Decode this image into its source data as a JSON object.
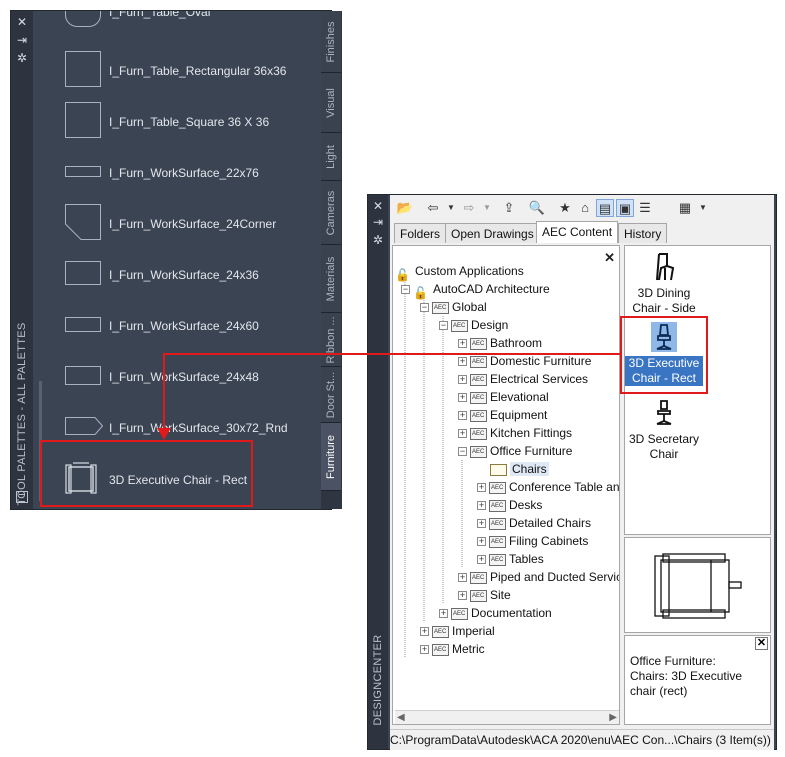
{
  "tool_palette": {
    "title": "TOOL PALETTES - ALL PALETTES",
    "controls": [
      "close-icon",
      "pin-icon",
      "properties-icon"
    ],
    "items": [
      {
        "label": "I_Furn_Table_Oval",
        "icon": "oval-table-icon"
      },
      {
        "label": "I_Furn_Table_Rectangular 36x36",
        "icon": "square-table-icon"
      },
      {
        "label": "I_Furn_Table_Square 36 X 36",
        "icon": "square-table-icon"
      },
      {
        "label": "I_Furn_WorkSurface_22x76",
        "icon": "worksurface-icon"
      },
      {
        "label": "I_Furn_WorkSurface_24Corner",
        "icon": "corner-worksurface-icon"
      },
      {
        "label": "I_Furn_WorkSurface_24x36",
        "icon": "worksurface-icon"
      },
      {
        "label": "I_Furn_WorkSurface_24x60",
        "icon": "worksurface-icon"
      },
      {
        "label": "I_Furn_WorkSurface_24x48",
        "icon": "worksurface-icon"
      },
      {
        "label": "I_Furn_WorkSurface_30x72_Rnd",
        "icon": "rounded-worksurface-icon"
      },
      {
        "label": "3D Executive Chair - Rect",
        "icon": "chair-icon"
      }
    ],
    "tabs": [
      "Finishes",
      "Visual",
      "Light",
      "Cameras",
      "Materials",
      "Ribbon ...",
      "Door St...",
      "Furniture"
    ],
    "active_tab": "Furniture"
  },
  "design_center": {
    "title": "DESIGNCENTER",
    "toolbar": [
      "load-icon",
      "back-icon",
      "forward-icon",
      "up-icon",
      "search-icon",
      "favorites-icon",
      "home-icon",
      "tree-toggle-icon",
      "preview-icon",
      "description-icon",
      "views-icon"
    ],
    "tabs": [
      "Folders",
      "Open Drawings",
      "AEC Content",
      "History"
    ],
    "active_tab": "AEC Content",
    "tree": [
      {
        "label": "Custom Applications",
        "expand": "",
        "icon": "cust"
      },
      {
        "label": "AutoCAD Architecture",
        "expand": "−",
        "icon": "cust"
      },
      {
        "label": "Global",
        "expand": "−",
        "icon": "aec"
      },
      {
        "label": "Design",
        "expand": "−",
        "icon": "aec"
      },
      {
        "label": "Bathroom",
        "expand": "+",
        "icon": "aec"
      },
      {
        "label": "Domestic Furniture",
        "expand": "+",
        "icon": "aec"
      },
      {
        "label": "Electrical Services",
        "expand": "+",
        "icon": "aec"
      },
      {
        "label": "Elevational",
        "expand": "+",
        "icon": "aec"
      },
      {
        "label": "Equipment",
        "expand": "+",
        "icon": "aec"
      },
      {
        "label": "Kitchen Fittings",
        "expand": "+",
        "icon": "aec"
      },
      {
        "label": "Office Furniture",
        "expand": "−",
        "icon": "aec"
      },
      {
        "label": "Chairs",
        "expand": "",
        "icon": "plain"
      },
      {
        "label": "Conference Table and",
        "expand": "+",
        "icon": "aec"
      },
      {
        "label": "Desks",
        "expand": "+",
        "icon": "aec"
      },
      {
        "label": "Detailed Chairs",
        "expand": "+",
        "icon": "aec"
      },
      {
        "label": "Filing Cabinets",
        "expand": "+",
        "icon": "aec"
      },
      {
        "label": "Tables",
        "expand": "+",
        "icon": "aec"
      },
      {
        "label": "Piped and Ducted Service",
        "expand": "+",
        "icon": "aec"
      },
      {
        "label": "Site",
        "expand": "+",
        "icon": "aec"
      },
      {
        "label": "Documentation",
        "expand": "+",
        "icon": "aec"
      },
      {
        "label": "Imperial",
        "expand": "+",
        "icon": "aec"
      },
      {
        "label": "Metric",
        "expand": "+",
        "icon": "aec"
      }
    ],
    "content_items": [
      {
        "label": "3D Dining Chair - Side",
        "icon": "dining-chair-icon"
      },
      {
        "label": "3D Executive Chair - Rect",
        "icon": "executive-chair-icon",
        "selected": true
      },
      {
        "label": "3D Secretary Chair",
        "icon": "secretary-chair-icon"
      }
    ],
    "description": "Office Furniture: Chairs: 3D Executive chair (rect)",
    "status": "C:\\ProgramData\\Autodesk\\ACA 2020\\enu\\AEC Con...\\Chairs (3 Item(s))"
  },
  "accent_color": "#e0191b"
}
